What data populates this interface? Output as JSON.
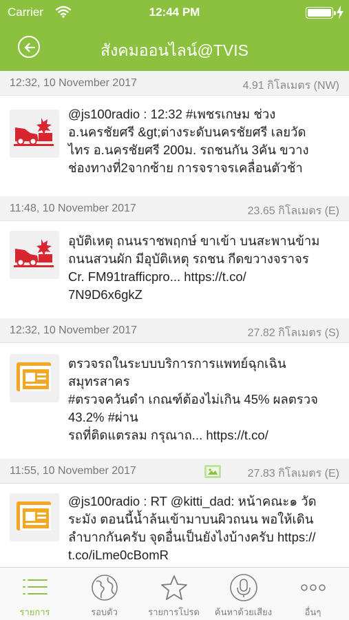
{
  "status_bar": {
    "carrier": "Carrier",
    "time": "12:44 PM"
  },
  "header": {
    "title": "สังคมออนไลน์@TVIS"
  },
  "feed": [
    {
      "date": "12:32, 10 November 2017",
      "distance": "4.91 กิโลเมตร (NW)",
      "icon": "car-crash-icon",
      "lines": [
        "@js100radio : 12:32 #เพชรเกษม ช่วง",
        "อ.นครชัยศรี &gt;ต่างระดับนครชัยศรี เลยวัด",
        "ไทร อ.นครชัยศรี 200ม. รถชนกัน 3คัน ขวาง",
        "ช่องทางที่2จากซ้าย การจราจรเคลื่อนตัวช้า"
      ]
    },
    {
      "date": "11:48, 10 November 2017",
      "distance": "23.65 กิโลเมตร (E)",
      "icon": "car-crash-icon",
      "lines": [
        "อุบัติเหตุ ถนนราชพฤกษ์ ขาเข้า บนสะพานข้าม",
        "ถนนสวนผัก มีอุบัติเหตุ รถชน กีดขวางจราจร",
        "Cr. FM91trafficpro... https://t.co/",
        "7N9D6x6gkZ"
      ]
    },
    {
      "date": "12:32, 10 November 2017",
      "distance": "27.82 กิโลเมตร (S)",
      "icon": "news-icon",
      "lines": [
        "ตรวจรถในระบบบริการการแพทย์ฉุกเฉิน",
        "สมุทรสาคร",
        "#ตรวจควันดำ เกณฑ์ต้องไม่เกิน 45% ผลตรวจ",
        "43.2% #ผ่าน",
        "รถที่ติดแตรลม กรุณาถ... https://t.co/"
      ]
    },
    {
      "date": "11:55, 10 November 2017",
      "distance": "27.83 กิโลเมตร (E)",
      "icon": "news-icon",
      "has_image": true,
      "lines": [
        "@js100radio : RT @kitti_dad: หน้าคณะ๑ วัด",
        "ระมัง ตอนนี้น้ำล้นเข้ามาบนผิวถนน พอให้เดิน",
        "ลำบากกันครับ จุดอื่นเป็นยังไงบ้างครับ https://",
        "t.co/iLme0cBomR"
      ]
    }
  ],
  "tabs": [
    {
      "label": "รายการ",
      "icon": "list-icon",
      "active": true
    },
    {
      "label": "รอบตัว",
      "icon": "globe-icon",
      "active": false
    },
    {
      "label": "รายการโปรด",
      "icon": "star-icon",
      "active": false
    },
    {
      "label": "ค้นหาด้วยเสียง",
      "icon": "microphone-icon",
      "active": false
    },
    {
      "label": "อื่นๆ",
      "icon": "more-icon",
      "active": false
    }
  ],
  "colors": {
    "primary": "#8cc140",
    "crash_red": "#d7262f",
    "news_orange": "#f5a623",
    "section_bg": "#f2f2f2",
    "tab_inactive": "#7d7d7d"
  }
}
